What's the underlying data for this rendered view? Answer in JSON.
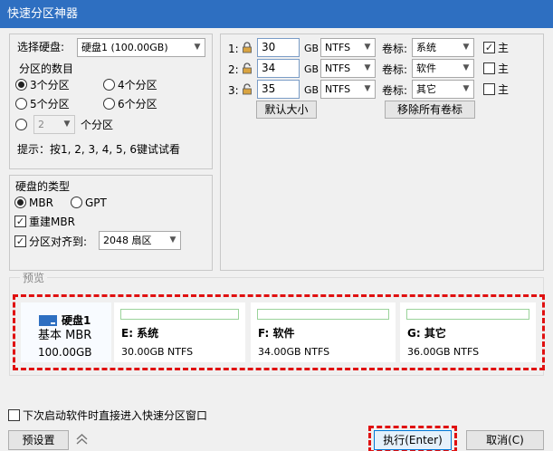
{
  "window": {
    "title": "快速分区神器"
  },
  "disk_group": {
    "select_disk_label": "选择硬盘:",
    "selected_disk": "硬盘1 (100.00GB)",
    "count_label": "分区的数目",
    "options": [
      "3个分区",
      "4个分区",
      "5个分区",
      "6个分区"
    ],
    "custom_count": "2",
    "custom_suffix": "个分区",
    "hint": "提示：按1, 2, 3, 4, 5, 6键试试看"
  },
  "type_group": {
    "title": "硬盘的类型",
    "mbr": "MBR",
    "gpt": "GPT",
    "rebuild_mbr": "重建MBR",
    "align_label": "分区对齐到:",
    "align_value": "2048 扇区"
  },
  "partitions": [
    {
      "index": "1:",
      "size": "30",
      "unit": "GB",
      "fs": "NTFS",
      "label_caption": "卷标:",
      "label": "系统",
      "primary_caption": "主",
      "primary": true
    },
    {
      "index": "2:",
      "size": "34",
      "unit": "GB",
      "fs": "NTFS",
      "label_caption": "卷标:",
      "label": "软件",
      "primary_caption": "主",
      "primary": false
    },
    {
      "index": "3:",
      "size": "35",
      "unit": "GB",
      "fs": "NTFS",
      "label_caption": "卷标:",
      "label": "其它",
      "primary_caption": "主",
      "primary": false
    }
  ],
  "buttons": {
    "default_size": "默认大小",
    "remove_labels": "移除所有卷标",
    "preset": "预设置",
    "execute": "执行(Enter)",
    "cancel": "取消(C)"
  },
  "preview": {
    "title": "预览",
    "disk_name": "硬盘1",
    "disk_type": "基本 MBR",
    "disk_size": "100.00GB",
    "parts": [
      {
        "name": "E: 系统",
        "info": "30.00GB NTFS"
      },
      {
        "name": "F: 软件",
        "info": "34.00GB NTFS"
      },
      {
        "name": "G: 其它",
        "info": "36.00GB NTFS"
      }
    ]
  },
  "footer": {
    "autostart_label": "下次启动软件时直接进入快速分区窗口"
  },
  "colors": {
    "titlebar": "#2e6fc1",
    "highlight": "#e01010",
    "disk_icon": "#2e6fc1",
    "bar_border": "#9bd39b"
  }
}
